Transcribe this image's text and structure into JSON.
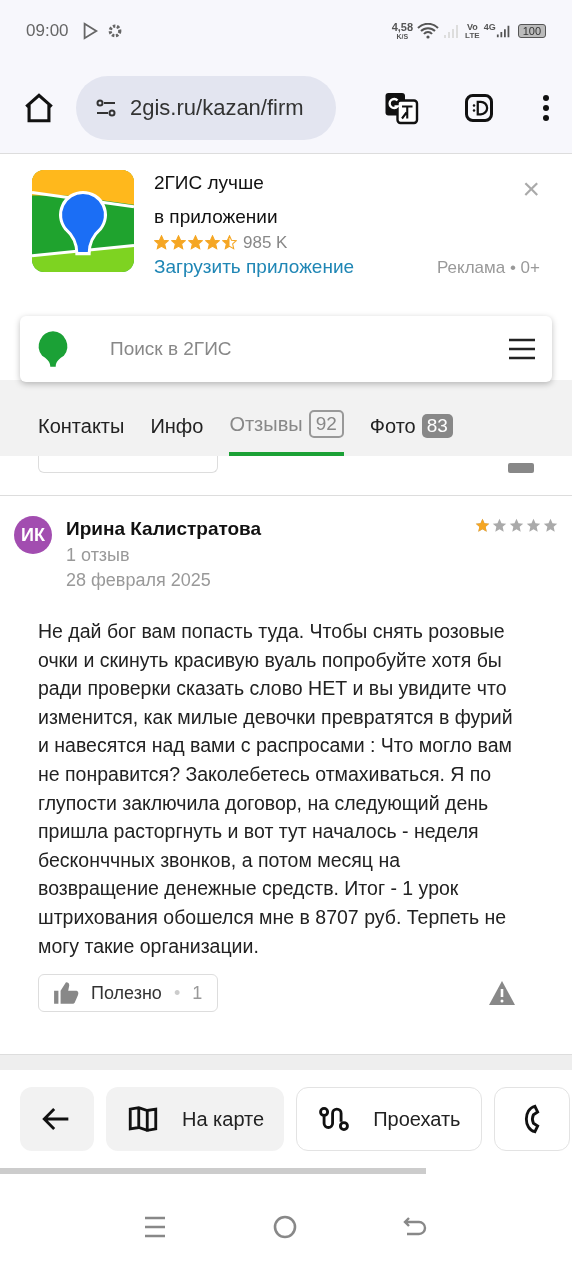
{
  "status_bar": {
    "time": "09:00",
    "speed": "4,58",
    "speed_unit": "K/S",
    "volte": "Vo",
    "volte_sub": "LTE",
    "network": "4G",
    "battery": "100"
  },
  "browser": {
    "url": "2gis.ru/kazan/firm"
  },
  "ad": {
    "title": "2ГИС лучше",
    "subtitle": "в приложении",
    "stars": 4.5,
    "rating_count": "985 K",
    "link": "Загрузить приложение",
    "label": "Реклама • 0+",
    "close": "×"
  },
  "search": {
    "placeholder": "Поиск в 2ГИС"
  },
  "tabs": [
    {
      "label": "Контакты",
      "selected": false
    },
    {
      "label": "Инфо",
      "selected": false
    },
    {
      "label": "Отзывы",
      "count": "92",
      "selected": true
    },
    {
      "label": "Фото",
      "count": "83",
      "selected": false
    }
  ],
  "review": {
    "initials": "ИК",
    "author": "Ирина Калистратова",
    "meta": "1 отзыв",
    "date": "28 февраля 2025",
    "stars": 1,
    "text": "Не дай бог вам попасть туда. Чтобы снять розовые очки и скинуть красивую вуаль попробуйте хотя бы ради проверки сказать слово НЕТ и вы увидите что изменится, как милые девочки превратятся в фурий и навесятся над вами с распросами : Что могло вам не понравится? Заколебетесь отмахиваться. Я по глупости заключила договор, на следующий день пришла расторгнуть и вот тут началось - неделя бесконччных звонков, а потом месяц на возвращение денежные средств. Итог - 1 урок штрихования обошелся мне в 8707 руб. Терпеть не могу такие организации.",
    "useful_label": "Полезно",
    "useful_sep": "•",
    "useful_count": "1"
  },
  "actions": [
    {
      "kind": "back"
    },
    {
      "kind": "map",
      "label": "На карте"
    },
    {
      "kind": "route",
      "label": "Проехать"
    },
    {
      "kind": "phone"
    }
  ]
}
